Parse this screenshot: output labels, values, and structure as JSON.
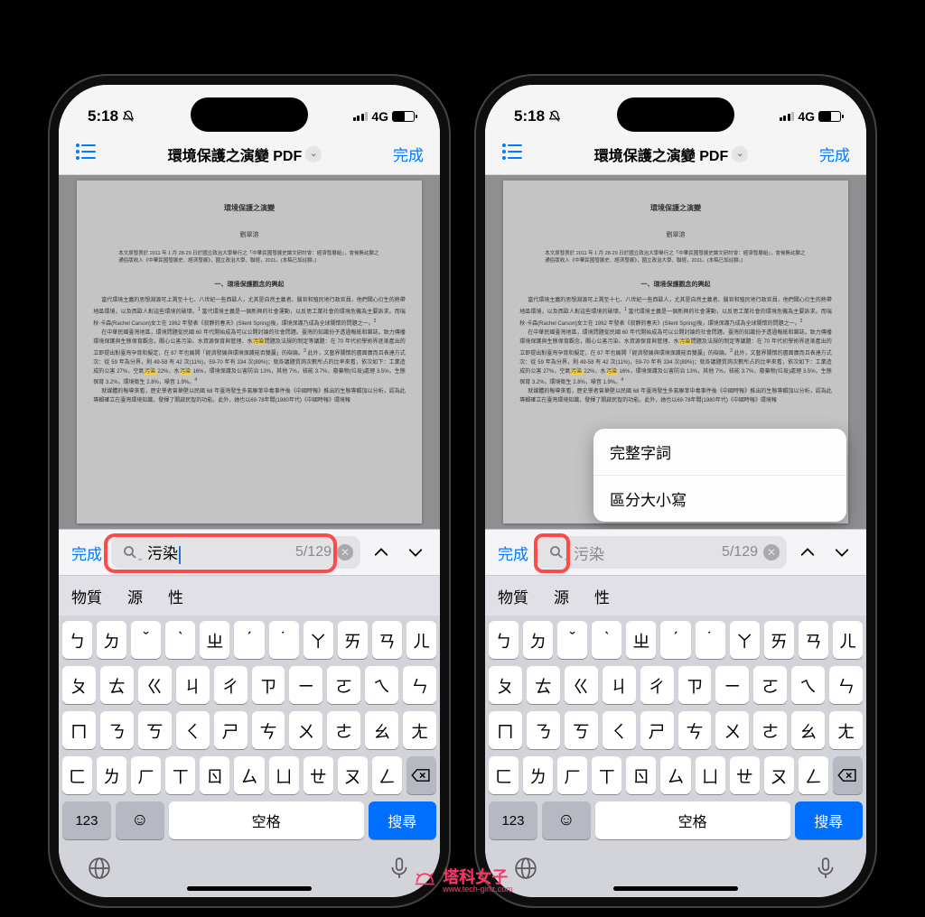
{
  "statusbar": {
    "time": "5:18",
    "network": "4G"
  },
  "navbar": {
    "title": "環境保護之演變 PDF",
    "done": "完成"
  },
  "document": {
    "title": "環境保護之演變",
    "author": "劉翠溶",
    "abstract": "本文原發表於 2011 年 1 月 28-29 日於國立政治大學舉行之「中華民國發展史論文研討會：經濟發展組」，會後無註腳之通俗版收入《中華民國發展史．經濟發展》，國立政治大學、聯經，2011。(本稿已加註腳。)",
    "heading1": "一、環境保護觀念的興起",
    "para1a": "當代環境主義的思想淵源可上溯至十七、八世紀一些西歐人，尤其是自然主義者、醫官和殖民地行政官員，他們關心衍生的熱帶地區環境，以及西歐人對這些環境的破壞。",
    "para1b": "當代環境主義是一個新興的社會運動，以反思工業社會的環境危機為主要訴求。而瑞秋·卡森(Rachel Carson)女士在 1962 年發表《寂靜的春天》(Silent Spring)後，環境保護乃成為全球關懷的問題之一。",
    "para2_pre": "在中華民國臺灣地區，環境問題從民國 60 年代開始成為可以公開討論的社會問題。臺灣的知識份子透過報紙和雜誌，致力傳播環境保護與生態保育觀念，關心公害污染、水資源保育與管理、水",
    "para2_hl1": "污染",
    "para2_mid": "問題及法規的制定等議題：在 70 年代初學術界逐漸產出的立即提出對臺灣孕育和擬定，在 87 年也展開「經濟發展與環境保護能否雙贏」的辯論。",
    "para2_mid2": "此外，文藝界關懷的層面廣而且表達方式次：從 59 年為分界，則 49-58 有 42 次(11%)，59-70 年有 334 次(89%)；就各議題質詢次數所占的比率來看，依次如下：工業造成的公害 27%，空氣",
    "para2_hl2": "污染",
    "para2_mid3": " 22%，水",
    "para2_hl3": "污染",
    "para2_mid4": " 16%，環境保護及公害防治 13%，其他 7%，核能 3.7%，廢棄物(垃圾)處理 3.5%，生態保育 3.2%，環境衛生 2.8%，噪音 1.9%。",
    "para3": "就媒體的報導來看，歷史學者曾華壁以民國 68 年臺灣發生多氯聯苯中毒事件後《中國時報》推出的生態專輯加以分析，認為此專輯確立在臺灣環境知識，發揮了開啟民智的功能。此外，她也以69-78年間(1980年代)《中國時報》環境報"
  },
  "search": {
    "done": "完成",
    "query": "污染",
    "count": "5/129"
  },
  "popup": {
    "opt1": "完整字詞",
    "opt2": "區分大小寫"
  },
  "predict": {
    "s1": "物質",
    "s2": "源",
    "s3": "性"
  },
  "keyboard": {
    "rows": [
      [
        "ㄅ",
        "ㄉ",
        "ˇ",
        "ˋ",
        "ㄓ",
        "ˊ",
        "˙",
        "ㄚ",
        "ㄞ",
        "ㄢ",
        "ㄦ"
      ],
      [
        "ㄆ",
        "ㄊ",
        "ㄍ",
        "ㄐ",
        "ㄔ",
        "ㄗ",
        "ㄧ",
        "ㄛ",
        "ㄟ",
        "ㄣ"
      ],
      [
        "ㄇ",
        "ㄋ",
        "ㄎ",
        "ㄑ",
        "ㄕ",
        "ㄘ",
        "ㄨ",
        "ㄜ",
        "ㄠ",
        "ㄤ"
      ],
      [
        "ㄈ",
        "ㄌ",
        "ㄏ",
        "ㄒ",
        "ㄖ",
        "ㄙ",
        "ㄩ",
        "ㄝ",
        "ㄡ",
        "ㄥ"
      ]
    ],
    "num": "123",
    "space": "空格",
    "search": "搜尋"
  },
  "watermark": {
    "name": "塔科女子",
    "url": "www.tech-girlz.com"
  }
}
